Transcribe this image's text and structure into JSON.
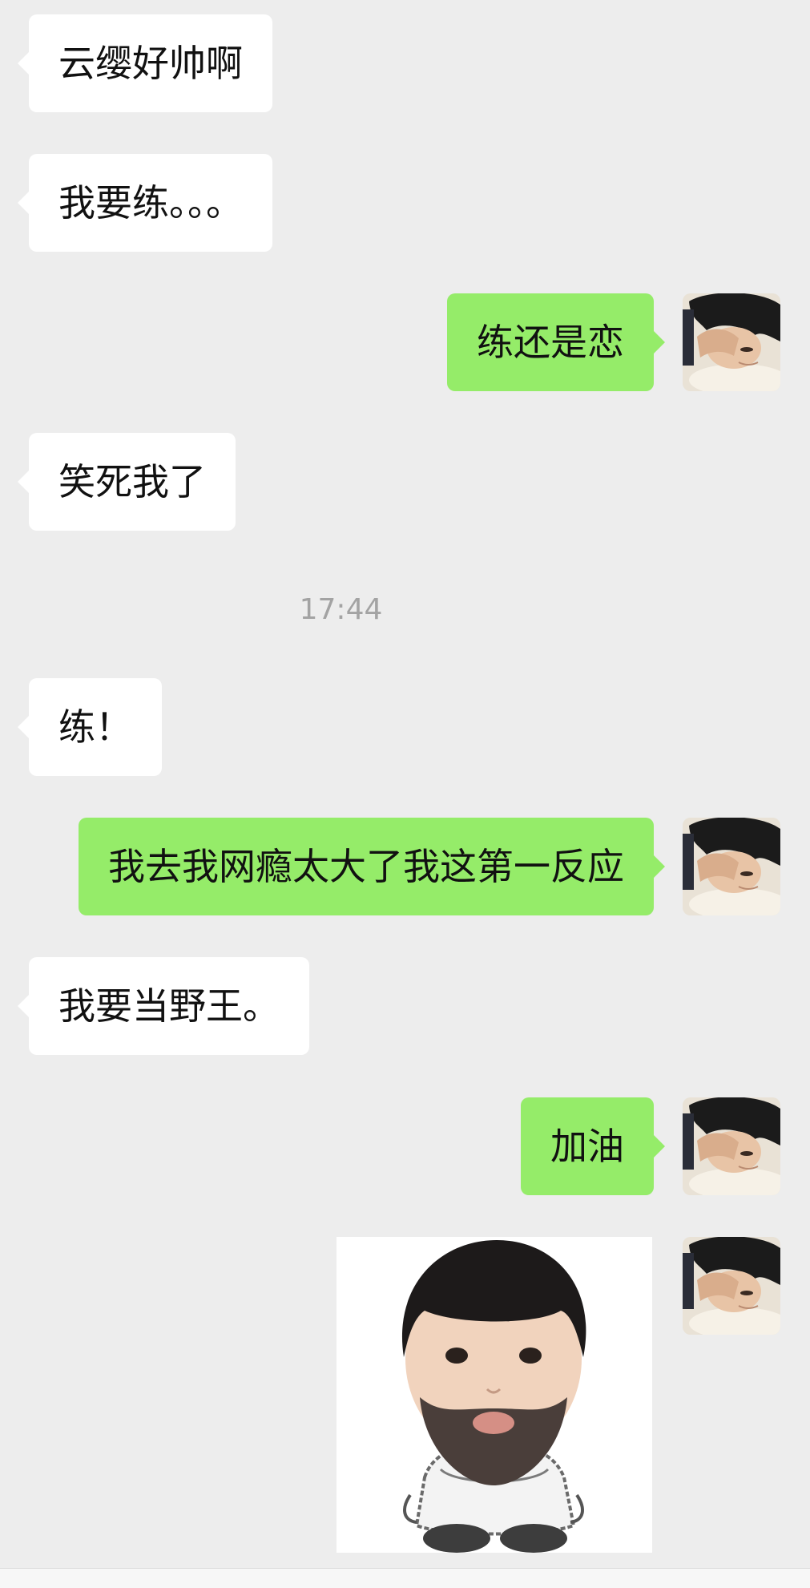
{
  "messages": [
    {
      "text": "云缨好帅啊"
    },
    {
      "text": "我要练。。。"
    },
    {
      "text": "练还是恋"
    },
    {
      "text": "笑死我了"
    },
    {
      "text": "练！"
    },
    {
      "text": "我去我网瘾太大了我这第一反应"
    },
    {
      "text": "我要当野王。"
    },
    {
      "text": "加油"
    }
  ],
  "timestamp": "17:44",
  "colors": {
    "background": "#ededed",
    "incoming_bubble": "#ffffff",
    "outgoing_bubble": "#95ec69",
    "timestamp_text": "#a3a3a3"
  },
  "icons": {
    "avatar": "avatar-photo",
    "sticker": "bearded-baby-sticker"
  }
}
